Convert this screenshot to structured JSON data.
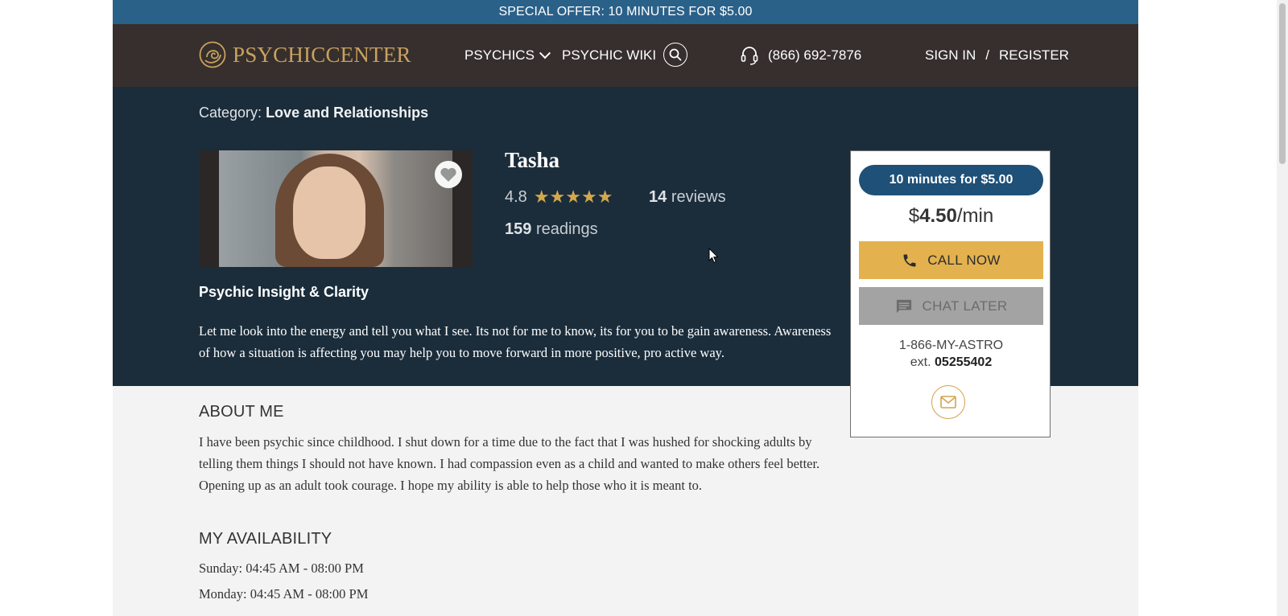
{
  "offer_bar": {
    "text": "SPECIAL OFFER: 10 MINUTES FOR $5.00"
  },
  "header": {
    "logo_text": "PSYCHICCENTER",
    "nav": {
      "psychics": "PSYCHICS",
      "wiki": "PSYCHIC WIKI"
    },
    "phone": "(866) 692-7876",
    "sign_in": "SIGN IN",
    "separator": "/",
    "register": "REGISTER"
  },
  "hero": {
    "category_label": "Category:",
    "category_value": "Love and Relationships",
    "name": "Tasha",
    "rating": "4.8",
    "stars": "★★★★★",
    "reviews_count": "14",
    "reviews_label": "reviews",
    "readings_count": "159",
    "readings_label": "readings",
    "tagline": "Psychic Insight & Clarity",
    "description": "Let me look into the energy and tell you what I see. Its not for me to know, its for you to be gain awareness. Awareness of how a situation is affecting you may help you to move forward in more positive, pro active way."
  },
  "card": {
    "offer_pill": "10 minutes for $5.00",
    "price_currency": "$",
    "price_value": "4.50",
    "price_unit": "/min",
    "call_now": "CALL NOW",
    "chat_later": "CHAT LATER",
    "phone_line": "1-866-MY-ASTRO",
    "ext_label": "ext.",
    "ext_value": "05255402"
  },
  "about": {
    "heading": "ABOUT ME",
    "text": "I have been psychic since childhood. I shut down for a time due to the fact that I was hushed for shocking adults by telling them things I should not have known. I had compassion even as a child and wanted to make others feel better. Opening up as an adult took courage. I hope my ability is able to help those who it is meant to."
  },
  "availability": {
    "heading": "MY AVAILABILITY",
    "rows": [
      "Sunday: 04:45 AM - 08:00 PM",
      "Monday: 04:45 AM - 08:00 PM"
    ]
  },
  "colors": {
    "offer_bar": "#2a6189",
    "header": "#362f2d",
    "hero": "#1b2d3b",
    "gold": "#e3b24f",
    "pill": "#1e5078"
  },
  "icons": [
    "logo-swirl-icon",
    "chevron-down-icon",
    "search-icon",
    "headset-icon",
    "heart-icon",
    "phone-icon",
    "chat-icon",
    "mail-icon"
  ]
}
